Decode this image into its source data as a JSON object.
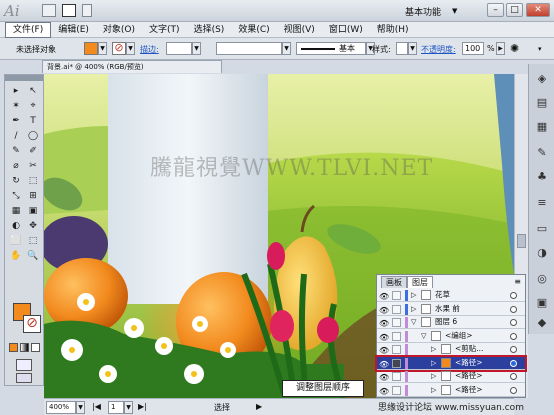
{
  "app": {
    "logo": "Ai",
    "workspace": "基本功能"
  },
  "window_buttons": {
    "minimize": "–",
    "maximize": "□",
    "close": "✕"
  },
  "menu": [
    "文件(F)",
    "编辑(E)",
    "对象(O)",
    "文字(T)",
    "选择(S)",
    "效果(C)",
    "视图(V)",
    "窗口(W)",
    "帮助(H)"
  ],
  "control_bar": {
    "selection_label": "未选择对象",
    "stroke_label": "描边:",
    "stroke_style": "基本",
    "style_label": "样式:",
    "opacity_label": "不透明度:",
    "opacity_value": "100",
    "opacity_unit": "%"
  },
  "colors": {
    "fill": "#f28a1e",
    "stroke": "#c0392b"
  },
  "document_tab": "背景.ai* @ 400% (RGB/预览)",
  "tools": [
    "▸",
    "↖",
    "✶",
    "⌖",
    "✒",
    "T",
    "/",
    "◯",
    "✎",
    "✐",
    "⌀",
    "✂",
    "↻",
    "⬚",
    "⤡",
    "⊞",
    "▦",
    "▣",
    "◐",
    "✥",
    "⬜",
    "⬚",
    "✋",
    "🔍"
  ],
  "status": {
    "zoom": "400%",
    "page": "1",
    "mode": "选择"
  },
  "layers_panel": {
    "tabs": [
      "画板",
      "图层"
    ],
    "rows": [
      {
        "name": "花草",
        "indent": 0,
        "color": "#3d6ee0",
        "expanded": false
      },
      {
        "name": "水果 前",
        "indent": 0,
        "color": "#3d6ee0",
        "expanded": false
      },
      {
        "name": "图层 6",
        "indent": 0,
        "color": "#c28bd8",
        "expanded": true
      },
      {
        "name": "<编组>",
        "indent": 1,
        "color": "#c28bd8",
        "expanded": true
      },
      {
        "name": "<剪贴...",
        "indent": 2,
        "color": "#c28bd8",
        "expanded": false
      },
      {
        "name": "<路径>",
        "indent": 2,
        "color": "#c28bd8",
        "expanded": false,
        "selected": true
      },
      {
        "name": "<路径>",
        "indent": 2,
        "color": "#c28bd8",
        "expanded": false
      },
      {
        "name": "<路径>",
        "indent": 2,
        "color": "#c28bd8",
        "expanded": false
      }
    ]
  },
  "caption": "调整图层顺序",
  "watermark": "騰龍視覺WWW.TLVI.NET",
  "footer_watermark": "思缘设计论坛 www.missyuan.com"
}
